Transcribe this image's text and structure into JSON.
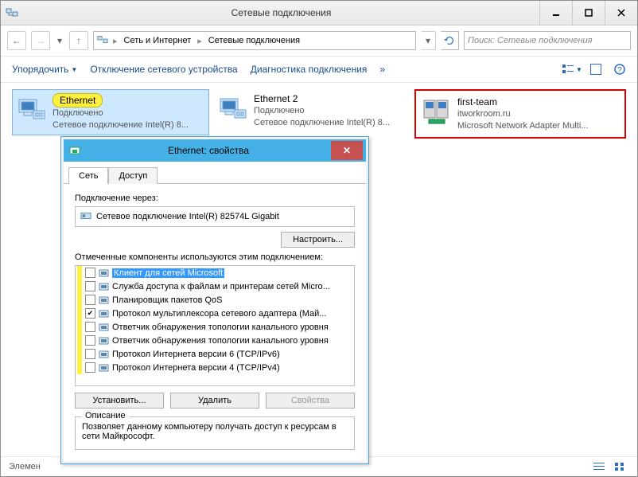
{
  "window": {
    "title": "Сетевые подключения",
    "search_placeholder": "Поиск: Сетевые подключения"
  },
  "breadcrumb": {
    "root": "Сеть и Интернет",
    "leaf": "Сетевые подключения"
  },
  "commands": {
    "organize": "Упорядочить",
    "disable": "Отключение сетевого устройства",
    "diagnose": "Диагностика подключения",
    "more": "»"
  },
  "connections": [
    {
      "name": "Ethernet",
      "status": "Подключено",
      "device": "Сетевое подключение Intel(R) 8...",
      "highlight": true
    },
    {
      "name": "Ethernet 2",
      "status": "Подключено",
      "device": "Сетевое подключение Intel(R) 8...",
      "highlight": false
    },
    {
      "name": "first-team",
      "status": "itworkroom.ru",
      "device": "Microsoft Network Adapter Multi...",
      "highlight": false
    }
  ],
  "dialog": {
    "title": "Ethernet: свойства",
    "tabs": {
      "network": "Сеть",
      "access": "Доступ"
    },
    "connect_via": "Подключение через:",
    "adapter": "Сетевое подключение Intel(R) 82574L Gigabit",
    "configure": "Настроить...",
    "components_label": "Отмеченные компоненты используются этим подключением:",
    "components": [
      {
        "label": "Клиент для сетей Microsoft",
        "checked": false,
        "selected": true
      },
      {
        "label": "Служба доступа к файлам и принтерам сетей Micro...",
        "checked": false,
        "selected": false
      },
      {
        "label": "Планировщик пакетов QoS",
        "checked": false,
        "selected": false
      },
      {
        "label": "Протокол мультиплексора сетевого адаптера (Май...",
        "checked": true,
        "selected": false
      },
      {
        "label": "Ответчик обнаружения топологии канального уровня",
        "checked": false,
        "selected": false
      },
      {
        "label": "Ответчик обнаружения топологии канального уровня",
        "checked": false,
        "selected": false
      },
      {
        "label": "Протокол Интернета версии 6 (TCP/IPv6)",
        "checked": false,
        "selected": false
      },
      {
        "label": "Протокол Интернета версии 4 (TCP/IPv4)",
        "checked": false,
        "selected": false
      }
    ],
    "install": "Установить...",
    "uninstall": "Удалить",
    "properties": "Свойства",
    "desc_legend": "Описание",
    "desc_text": "Позволяет данному компьютеру получать доступ к ресурсам в сети Майкрософт."
  },
  "statusbar": {
    "text": "Элемен"
  }
}
